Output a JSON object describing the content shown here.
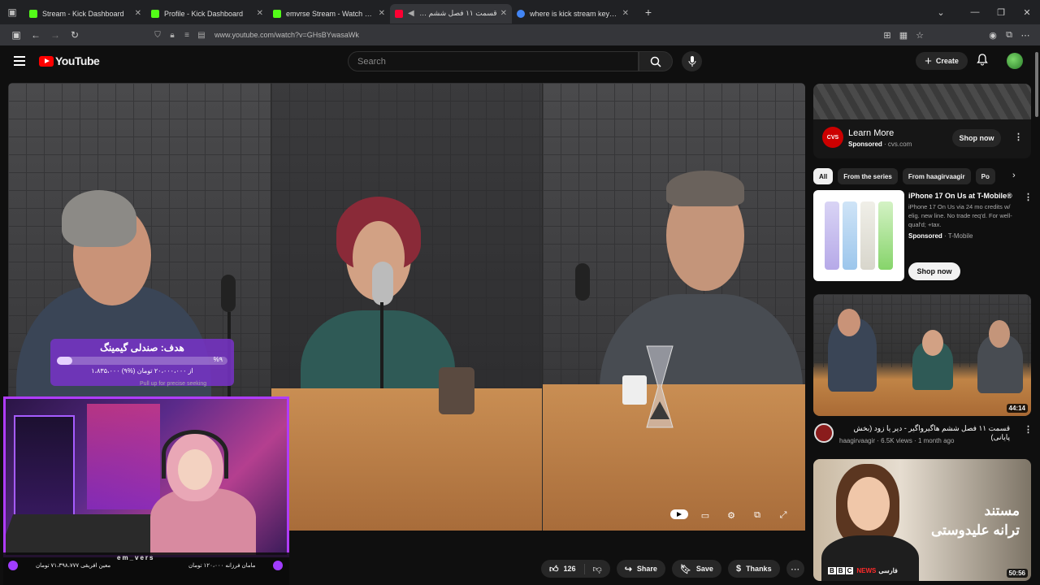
{
  "browser": {
    "tabs": [
      {
        "label": "Stream - Kick Dashboard",
        "color": "#53fc18",
        "active": false
      },
      {
        "label": "Profile - Kick Dashboard",
        "color": "#53fc18",
        "active": false
      },
      {
        "label": "emvrse Stream - Watch Live on",
        "color": "#53fc18",
        "active": false
      },
      {
        "label": "قسمت ۱۱ فصل ششم هاگیرو",
        "color": "#ff0033",
        "active": true
      },
      {
        "label": "where is kick stream key? - Goo",
        "color": "#4285f4",
        "active": false
      }
    ],
    "url": "www.youtube.com/watch?v=GHsBYwasaWk"
  },
  "youtube": {
    "logo_text": "YouTube",
    "search_placeholder": "Search",
    "create_label": "Create"
  },
  "player": {
    "goal_title": "هدف: صندلی گیمینگ",
    "goal_percent_label": "%۹",
    "goal_fraction": 0.09,
    "goal_amount": "۱،۸۳۵،۰۰۰ از ۲۰،۰۰۰،۰۰۰ تومان (%۹)",
    "seek_hint": "Pull up for precise seeking",
    "overlay_name": "em_vers",
    "overlay_left": "معین افریقی ۷۱،۳۹۸،۷۷۷ تومان",
    "overlay_right": "مامان فرزانه ۱۲۰،۰۰۰ تومان"
  },
  "actions": {
    "like_count": "126",
    "share": "Share",
    "save": "Save",
    "thanks": "Thanks"
  },
  "sidebar": {
    "ad": {
      "title": "Learn More",
      "sponsored": "Sponsored",
      "domain": "cvs.com",
      "logo": "CVS",
      "button": "Shop now"
    },
    "chips": [
      "All",
      "From the series",
      "From haagirvaagir",
      "Po"
    ],
    "promo": {
      "title": "iPhone 17 On Us at T-Mobile®",
      "desc": "iPhone 17 On Us via 24 mo credits w/ elig. new line. No trade req'd. For well-qual'd; +tax.",
      "sponsored": "Sponsored",
      "advertiser": "T-Mobile",
      "button": "Shop now"
    },
    "related": {
      "title": "قسمت ۱۱ فصل ششم هاگیرواگیر - دیر یا زود (بخش پایانی)",
      "channel": "haagirvaagir",
      "views": "6.5K views",
      "age": "1 month ago",
      "duration": "44:14"
    },
    "documentary": {
      "line1": "مستند",
      "line2": "ترانه علیدوستی",
      "news_label": "NEWS",
      "news_lang": "فارسی",
      "duration": "50:56"
    }
  }
}
